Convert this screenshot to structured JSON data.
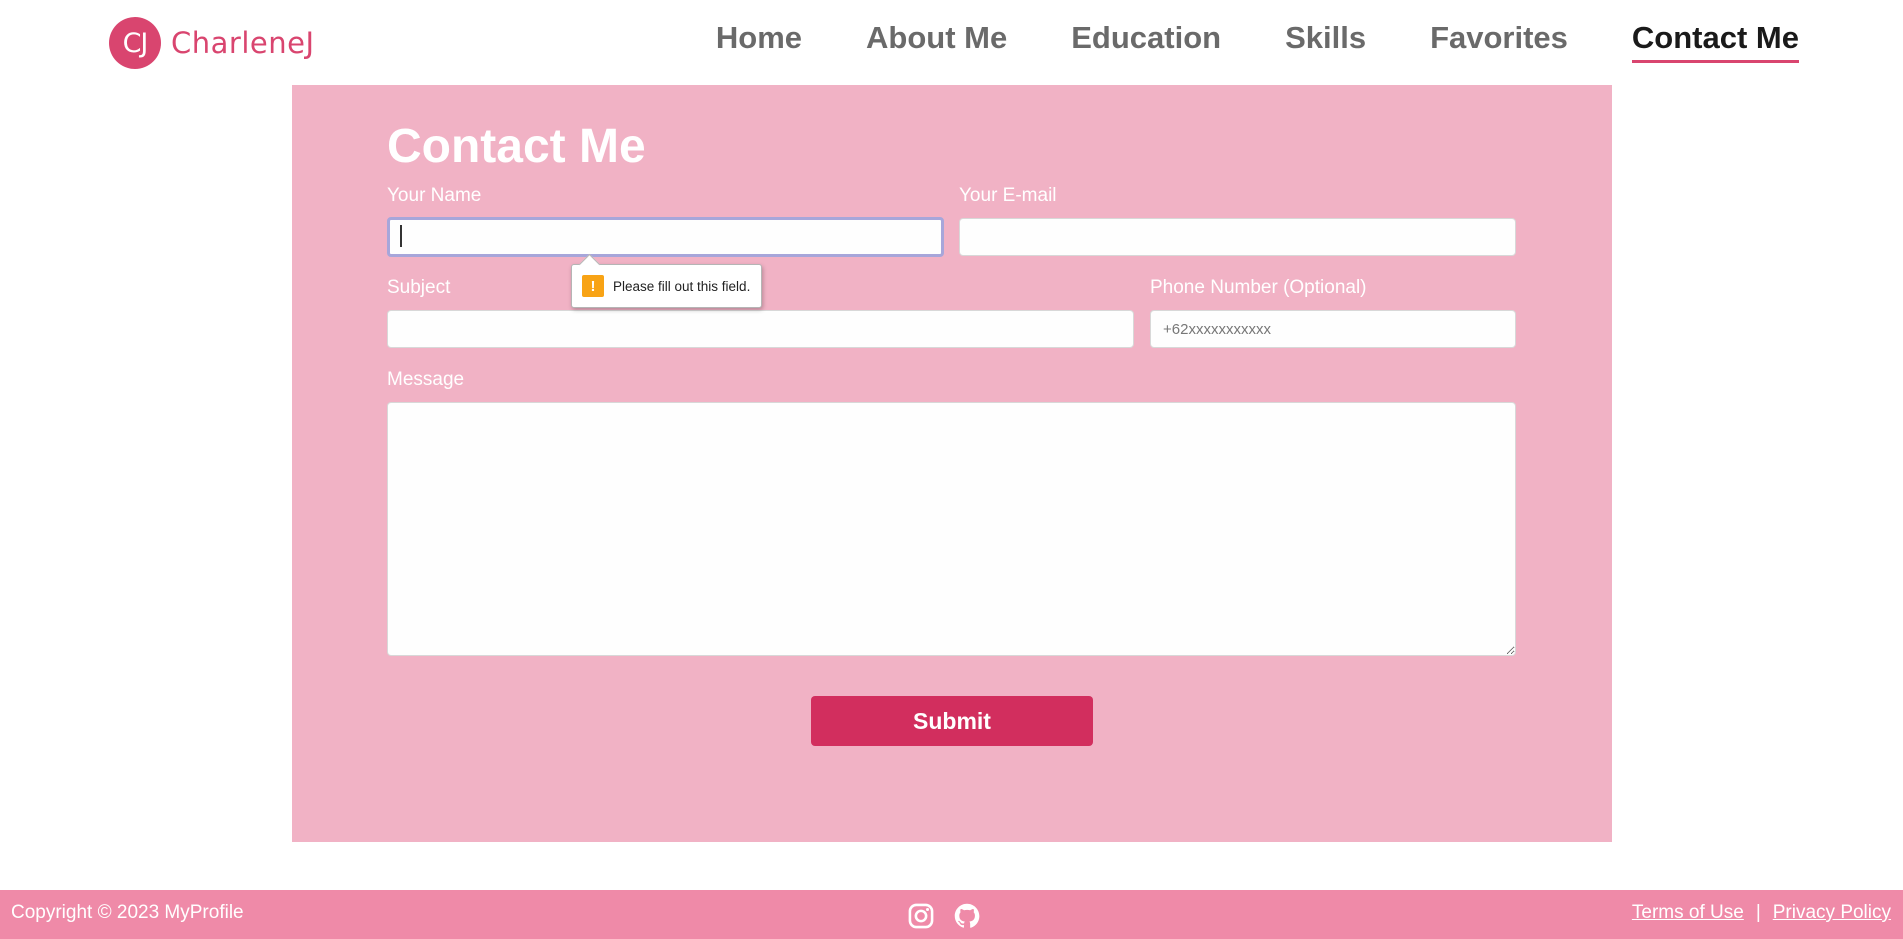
{
  "brand": {
    "initials": "CJ",
    "name": "CharleneJ"
  },
  "nav": {
    "items": [
      {
        "label": "Home"
      },
      {
        "label": "About Me"
      },
      {
        "label": "Education"
      },
      {
        "label": "Skills"
      },
      {
        "label": "Favorites"
      },
      {
        "label": "Contact Me"
      }
    ],
    "active": "Contact Me"
  },
  "contact": {
    "title": "Contact Me",
    "name_label": "Your Name",
    "name_value": "",
    "email_label": "Your E-mail",
    "email_value": "",
    "subject_label": "Subject",
    "subject_value": "",
    "phone_label": "Phone Number (Optional)",
    "phone_placeholder": "+62xxxxxxxxxxx",
    "message_label": "Message",
    "message_value": "",
    "submit_label": "Submit"
  },
  "validation": {
    "message": "Please fill out this field.",
    "icon": "warning-icon",
    "icon_glyph": "!"
  },
  "footer": {
    "copyright": "Copyright © 2023 MyProfile",
    "socials": [
      {
        "icon": "instagram-icon"
      },
      {
        "icon": "github-icon"
      }
    ],
    "terms_label": "Terms of Use",
    "separator": "|",
    "privacy_label": "Privacy Policy"
  },
  "colors": {
    "accent": "#d9456f",
    "panel": "#f1b2c5",
    "submit": "#d22e5e",
    "footer": "#ef8aa8",
    "focus_ring": "#a7a6da",
    "warning": "#f8a315"
  }
}
